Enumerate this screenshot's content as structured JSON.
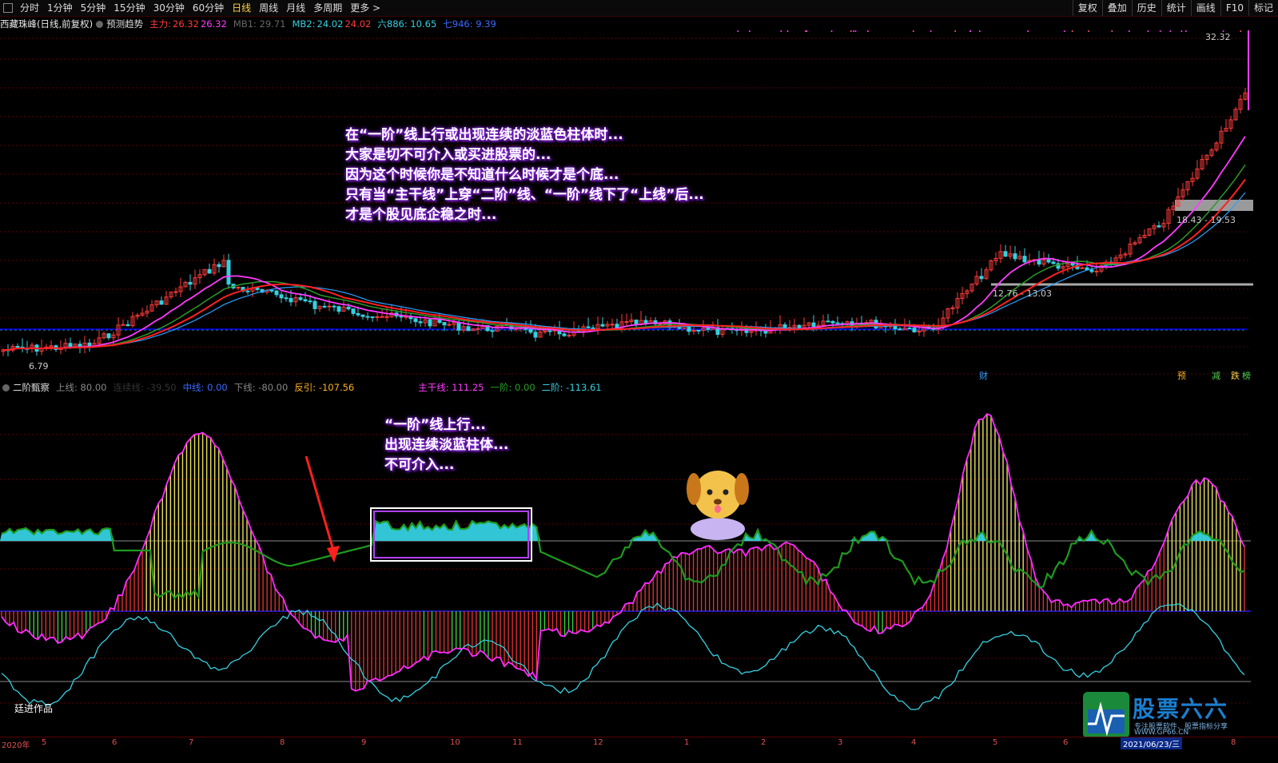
{
  "toolbar": {
    "periods": [
      "分时",
      "1分钟",
      "5分钟",
      "15分钟",
      "30分钟",
      "60分钟",
      "日线",
      "周线",
      "月线",
      "多周期",
      "更多 >"
    ],
    "active_period": "日线",
    "right_buttons": [
      "复权",
      "叠加",
      "历史",
      "统计",
      "画线",
      "F10",
      "标记"
    ]
  },
  "main_info": {
    "stock": "西藏珠峰(日线,前复权)",
    "predict": "预测趋势",
    "zhuli_label": "主力:",
    "zhuli_v1": "26.32",
    "zhuli_v2": "26.32",
    "mb1": "MB1: 29.71",
    "mb2_label": "MB2:",
    "mb2_v1": "24.02",
    "mb2_v2": "24.02",
    "liu": "六886: 10.65",
    "qi": "七946: 9.39"
  },
  "sub_info": {
    "name": "二阶甄察",
    "shangxian": "上线: 80.00",
    "lianxuxian": "连续线: -39.50",
    "zhongxian": "中线: 0.00",
    "xiaxian": "下线: -80.00",
    "fanyin": "反引: -107.56",
    "zhugan": "主干线: 111.25",
    "yijie": "一阶: 0.00",
    "erjie": "二阶: -113.61"
  },
  "price_labels": {
    "high": "32.32",
    "low": "6.79",
    "range1": "18.43 - 19.53",
    "range2": "12.76 - 13.03"
  },
  "annotations": {
    "main": [
      "在“一阶”线上行或出现连续的淡蓝色柱体时...",
      "大家是切不可介入或买进股票的...",
      "因为这个时候你是不知道什么时候才是个底...",
      "只有当“主干线”上穿“二阶”线、“一阶”线下了“上线”后...",
      "才是个股见底企稳之时..."
    ],
    "sub": [
      "“一阶”线上行...",
      "出现连续淡蓝柱体...",
      "不可介入..."
    ]
  },
  "markers": {
    "cai": "财",
    "yu": "预",
    "jian": "减",
    "die": "跌",
    "bang": "榜"
  },
  "dates": {
    "year": "2020年",
    "months": [
      "5",
      "6",
      "7",
      "8",
      "9",
      "10",
      "11",
      "12",
      "1",
      "2",
      "3",
      "4",
      "5",
      "6",
      "8"
    ],
    "current": "2021/06/23/三"
  },
  "author": "廷进作品",
  "watermark": {
    "title": "股票六六",
    "line1": "专注股票软件、股票指标分享",
    "line2": "WWW.GP66.CN"
  },
  "colors": {
    "up": "#ff3b3b",
    "down": "#35d0e0",
    "zhugan": "#ff2bff",
    "yijie": "#2aa02a",
    "erjie": "#35d0e0",
    "annot_glow": "#8a2be2"
  }
}
